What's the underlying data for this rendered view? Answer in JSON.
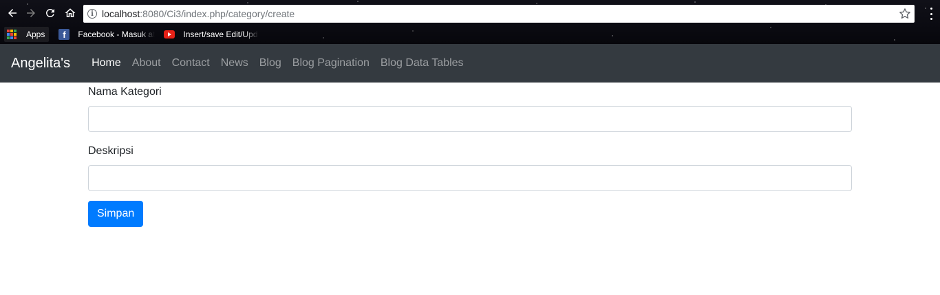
{
  "browser": {
    "url_host": "localhost",
    "url_rest": ":8080/Ci3/index.php/category/create",
    "bookmarks": [
      {
        "label": "Apps",
        "icon": "apps-grid-icon"
      },
      {
        "label": "Facebook - Masuk at",
        "icon": "facebook-icon"
      },
      {
        "label": "Insert/save Edit/Upd",
        "icon": "youtube-icon"
      }
    ]
  },
  "navbar": {
    "brand": "Angelita's",
    "links": [
      {
        "label": "Home",
        "active": true
      },
      {
        "label": "About",
        "active": false
      },
      {
        "label": "Contact",
        "active": false
      },
      {
        "label": "News",
        "active": false
      },
      {
        "label": "Blog",
        "active": false
      },
      {
        "label": "Blog Pagination",
        "active": false
      },
      {
        "label": "Blog Data Tables",
        "active": false
      }
    ]
  },
  "form": {
    "nama_label": "Nama Kategori",
    "nama_value": "",
    "deskripsi_label": "Deskripsi",
    "deskripsi_value": "",
    "submit_label": "Simpan"
  },
  "colors": {
    "navbar_bg": "#343a40",
    "primary": "#007bff",
    "input_border": "#ced4da"
  }
}
